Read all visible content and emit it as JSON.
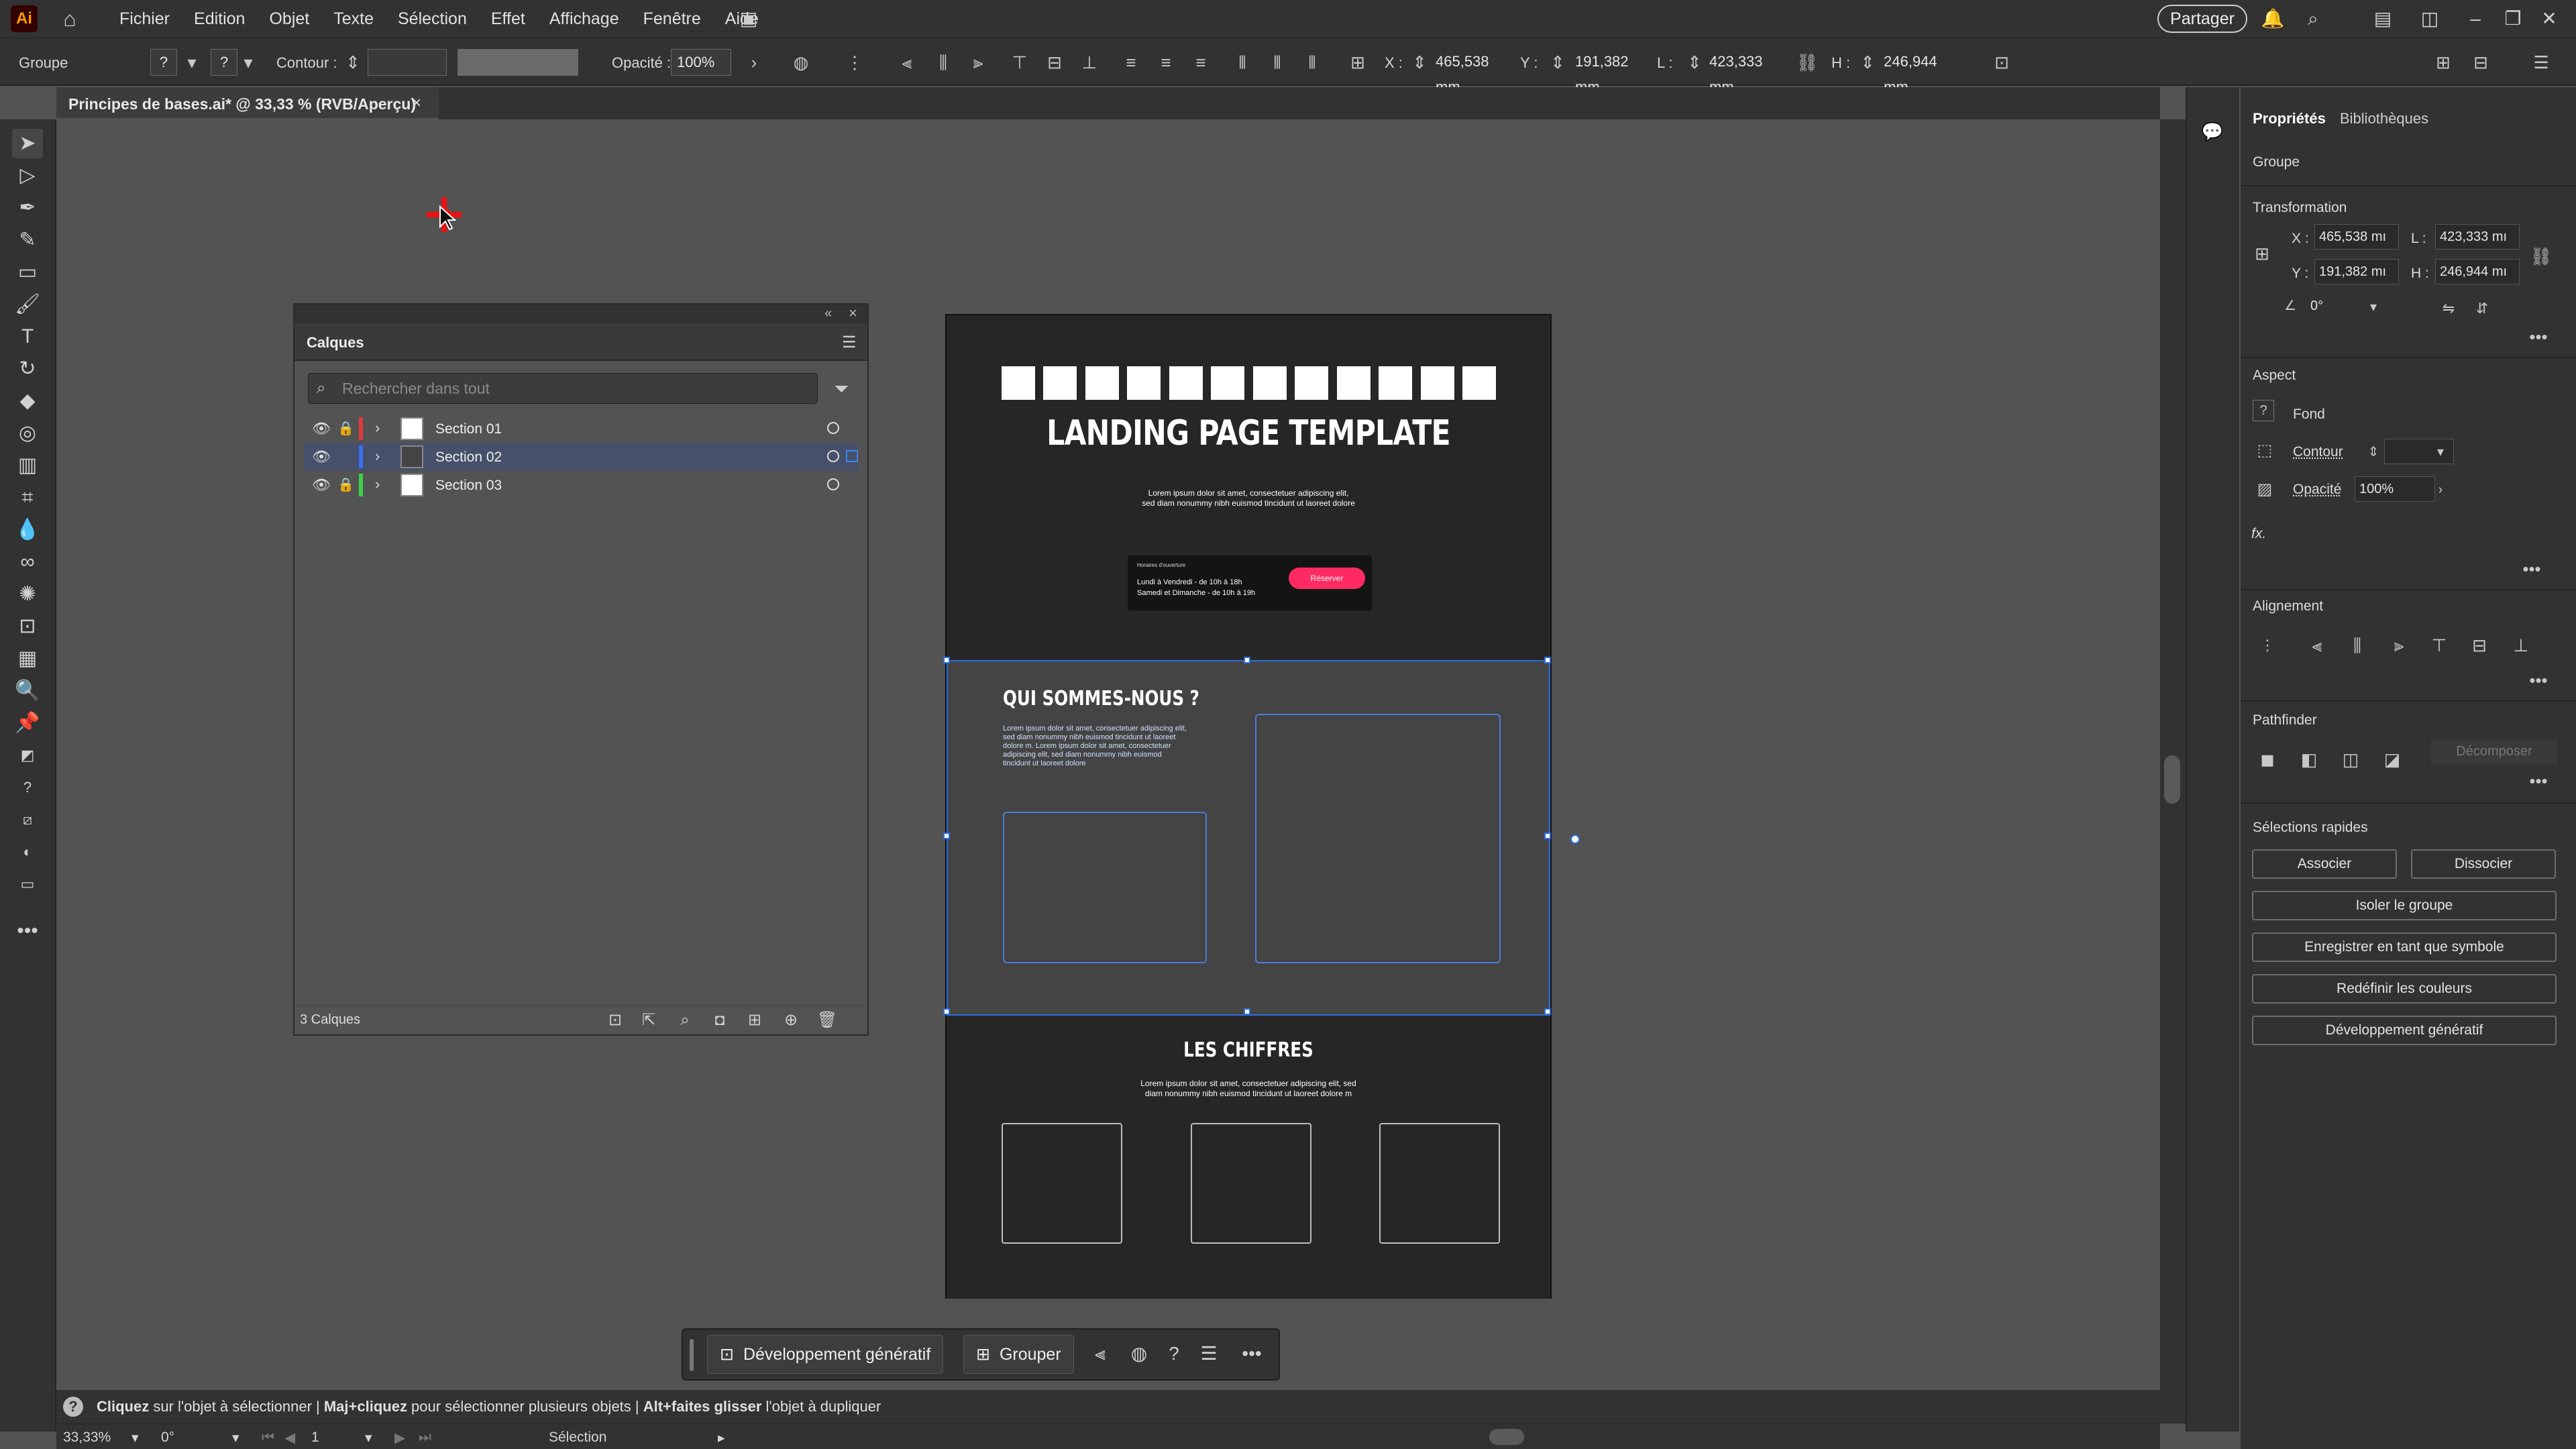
{
  "menubar": {
    "logo": "Ai",
    "items": [
      "Fichier",
      "Edition",
      "Objet",
      "Texte",
      "Sélection",
      "Effet",
      "Affichage",
      "Fenêtre",
      "Aide"
    ],
    "share": "Partager"
  },
  "control": {
    "object_type": "Groupe",
    "stroke_label": "Contour :",
    "opacity_label": "Opacité :",
    "opacity": "100%",
    "x_label": "X :",
    "x": "465,538 mm",
    "y_label": "Y :",
    "y": "191,382 mm",
    "l_label": "L :",
    "l": "423,333 mm",
    "h_label": "H :",
    "h": "246,944 mm"
  },
  "document_tab": {
    "title": "Principes de bases.ai* @ 33,33 % (RVB/Aperçu)"
  },
  "layers": {
    "title": "Calques",
    "search_placeholder": "Rechercher dans tout",
    "rows": [
      {
        "name": "Section 01",
        "color": "#e03a3a",
        "selected": false
      },
      {
        "name": "Section 02",
        "color": "#3b6ef0",
        "selected": true
      },
      {
        "name": "Section 03",
        "color": "#3ad04a",
        "selected": false
      }
    ],
    "count": "3 Calques"
  },
  "artboard": {
    "hero_title": "LANDING PAGE TEMPLATE",
    "hero_lorem_1": "Lorem ipsum dolor sit amet, consectetuer adipiscing elit,",
    "hero_lorem_2": "sed diam nonummy nibh euismod tincidunt ut laoreet dolore",
    "card_heading": "Horaires d'ouverture",
    "card_line_1": "Lundi à Vendredi - de 10h à 18h",
    "card_line_2": "Samedi et Dimanche - de 10h à 19h",
    "card_button": "Réserver",
    "about_title": "QUI SOMMES-NOUS ?",
    "about_lorem": "Lorem ipsum dolor sit amet, consectetuer adipiscing elit, sed diam nonummy nibh euismod tincidunt ut laoreet dolore m. Lorem ipsum dolor sit amet, consectetuer adipiscing elit, sed diam nonummy nibh euismod tincidunt ut laoreet dolore",
    "figures_title": "LES CHIFFRES",
    "figures_lorem_1": "Lorem ipsum dolor sit amet, consectetuer adipiscing elit, sed",
    "figures_lorem_2": "diam nonummy nibh euismod tincidunt ut laoreet dolore m"
  },
  "properties": {
    "tabs": [
      "Propriétés",
      "Bibliothèques"
    ],
    "object_type": "Groupe",
    "transform": {
      "title": "Transformation",
      "x_label": "X :",
      "x": "465,538 mı",
      "y_label": "Y :",
      "y": "191,382 mı",
      "l_label": "L :",
      "l": "423,333 mı",
      "h_label": "H :",
      "h": "246,944 mı",
      "angle": "0°"
    },
    "aspect": {
      "title": "Aspect",
      "fill": "Fond",
      "stroke": "Contour",
      "opacity_label": "Opacité",
      "opacity": "100%",
      "fx": "fx."
    },
    "alignment": {
      "title": "Alignement"
    },
    "pathfinder": {
      "title": "Pathfinder",
      "decompose": "Décomposer"
    },
    "quick": {
      "title": "Sélections rapides",
      "group": "Associer",
      "ungroup": "Dissocier",
      "isolate": "Isoler le groupe",
      "symbol": "Enregistrer en tant que symbole",
      "recolor": "Redéfinir les couleurs",
      "generative": "Développement génératif"
    }
  },
  "contextbar": {
    "generative": "Développement génératif",
    "group": "Grouper"
  },
  "hint": {
    "click": "Cliquez",
    "click_rest": " sur l'objet à sélectionner  |  ",
    "shift": "Maj+cliquez",
    "shift_rest": " pour sélectionner plusieurs objets  |  ",
    "alt": "Alt+faites glisser",
    "alt_rest": " l'objet à dupliquer"
  },
  "statusbar": {
    "zoom": "33,33%",
    "angle": "0°",
    "page": "1",
    "mode": "Sélection"
  }
}
